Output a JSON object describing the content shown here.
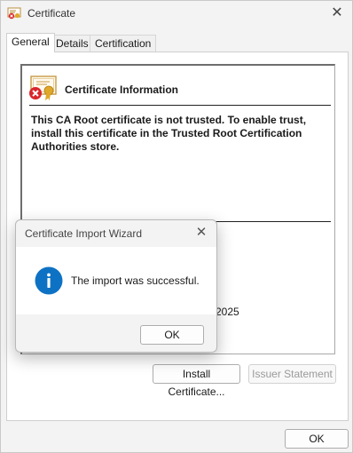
{
  "window": {
    "title": "Certificate",
    "close_glyph": "✕"
  },
  "tabs": [
    {
      "label": "General",
      "active": true
    },
    {
      "label": "Details",
      "active": false
    },
    {
      "label": "Certification Path",
      "active": false
    }
  ],
  "general": {
    "info_title": "Certificate Information",
    "warning_text": "This CA Root certificate is not trusted. To enable trust, install this certificate in the Trusted Root Certification Authorities store.",
    "valid_to_fragment": "2025",
    "install_button": "Install Certificate...",
    "issuer_button": "Issuer Statement",
    "issuer_button_enabled": false
  },
  "footer": {
    "ok_button": "OK"
  },
  "dialog": {
    "title": "Certificate Import Wizard",
    "close_glyph": "✕",
    "message": "The import was successful.",
    "ok_button": "OK",
    "icon": "info-icon"
  },
  "icons": {
    "title_icon": "certificate-icon",
    "cert_icon": "certificate-error-icon"
  },
  "colors": {
    "info_blue": "#0e72c4",
    "error_red": "#d9262b",
    "seal_gold": "#e0a82a"
  }
}
